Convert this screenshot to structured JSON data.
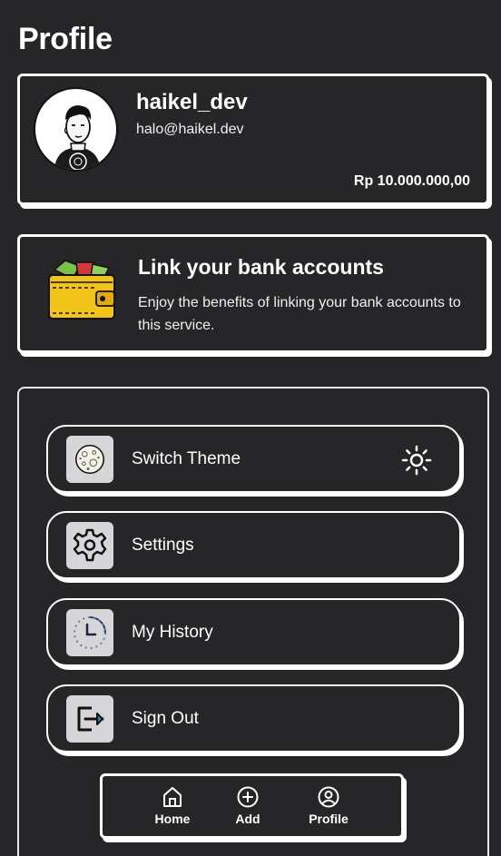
{
  "page": {
    "title": "Profile"
  },
  "profile": {
    "username": "haikel_dev",
    "email": "halo@haikel.dev",
    "balance": "Rp 10.000.000,00",
    "avatar_icon": "avatar-illustration"
  },
  "bank": {
    "title": "Link your bank accounts",
    "description": "Enjoy the benefits of linking your bank accounts to this service.",
    "icon": "wallet-icon"
  },
  "menu": {
    "items": [
      {
        "label": "Switch Theme",
        "icon": "moon-icon",
        "right_icon": "sun-icon"
      },
      {
        "label": "Settings",
        "icon": "gear-icon"
      },
      {
        "label": "My History",
        "icon": "history-icon"
      },
      {
        "label": "Sign Out",
        "icon": "sign-out-icon"
      }
    ]
  },
  "nav": {
    "items": [
      {
        "label": "Home",
        "icon": "home-icon"
      },
      {
        "label": "Add",
        "icon": "add-icon"
      },
      {
        "label": "Profile",
        "icon": "profile-icon"
      }
    ]
  },
  "colors": {
    "background": "#262628",
    "foreground": "#ffffff",
    "icon_box": "#d6d6d8",
    "wallet_yellow": "#f2c318"
  }
}
